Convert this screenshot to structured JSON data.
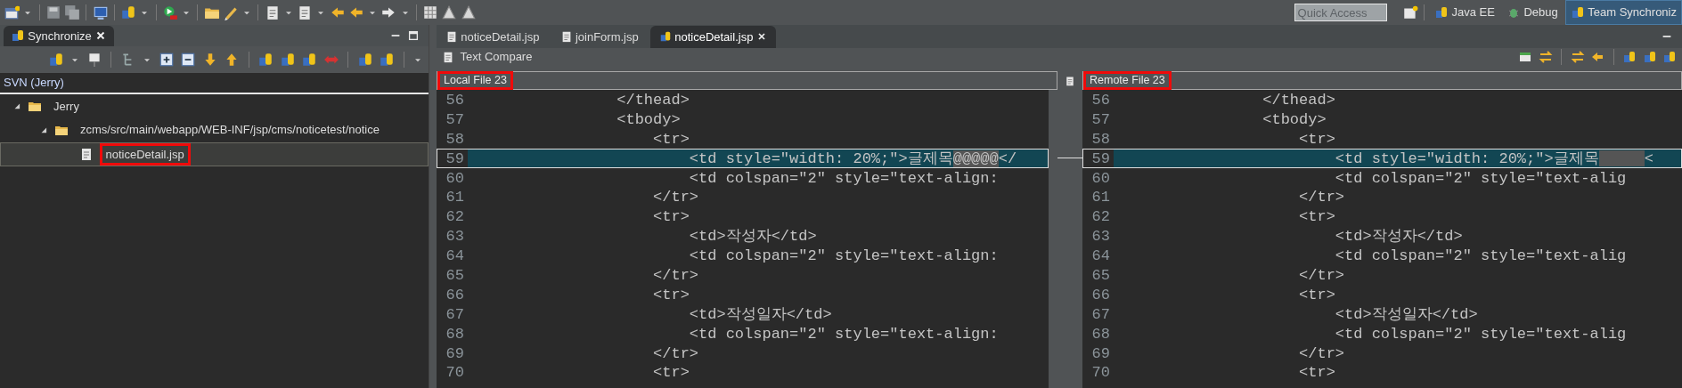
{
  "toolbar": {
    "quick_access": {
      "placeholder": "Quick Access"
    },
    "perspectives": [
      {
        "label": "Java EE",
        "selected": false
      },
      {
        "label": "Debug",
        "selected": false
      },
      {
        "label": "Team Synchroniz",
        "selected": true
      }
    ]
  },
  "sync_view": {
    "title": "Synchronize",
    "header": "SVN (Jerry)",
    "tree": [
      {
        "label": "Jerry",
        "kind": "project",
        "expanded": true,
        "selected": false,
        "highlighted": false,
        "children": [
          {
            "label": "zcms/src/main/webapp/WEB-INF/jsp/cms/noticetest/notice",
            "kind": "folder",
            "expanded": true,
            "selected": false,
            "highlighted": false,
            "children": [
              {
                "label": "noticeDetail.jsp",
                "kind": "file",
                "selected": true,
                "highlighted": true
              }
            ]
          }
        ]
      }
    ]
  },
  "editor": {
    "tabs": [
      {
        "label": "noticeDetail.jsp",
        "selected": false
      },
      {
        "label": "joinForm.jsp",
        "selected": false
      },
      {
        "label": "noticeDetail.jsp",
        "selected": true
      }
    ],
    "compare": {
      "title": "Text Compare",
      "left": {
        "header": "Local File 23",
        "highlighted": true,
        "lines": [
          {
            "number": "56",
            "code": "                </thead>",
            "selected": false
          },
          {
            "number": "57",
            "code": "                <tbody>",
            "selected": false
          },
          {
            "number": "58",
            "code": "                    <tr>",
            "selected": false
          },
          {
            "number": "59",
            "code": "                        <td style=\"width: 20%;\">글제목",
            "diff": "@@@@@",
            "tail": "</",
            "selected": true
          },
          {
            "number": "60",
            "code": "                        <td colspan=\"2\" style=\"text-align:",
            "selected": false
          },
          {
            "number": "61",
            "code": "                    </tr>",
            "selected": false
          },
          {
            "number": "62",
            "code": "                    <tr>",
            "selected": false
          },
          {
            "number": "63",
            "code": "                        <td>작성자</td>",
            "selected": false
          },
          {
            "number": "64",
            "code": "                        <td colspan=\"2\" style=\"text-align:",
            "selected": false
          },
          {
            "number": "65",
            "code": "                    </tr>",
            "selected": false
          },
          {
            "number": "66",
            "code": "                    <tr>",
            "selected": false
          },
          {
            "number": "67",
            "code": "                        <td>작성일자</td>",
            "selected": false
          },
          {
            "number": "68",
            "code": "                        <td colspan=\"2\" style=\"text-align:",
            "selected": false
          },
          {
            "number": "69",
            "code": "                    </tr>",
            "selected": false
          },
          {
            "number": "70",
            "code": "                    <tr>",
            "selected": false
          }
        ]
      },
      "right": {
        "header": "Remote File 23",
        "highlighted": true,
        "lines": [
          {
            "number": "56",
            "code": "                </thead>",
            "selected": false
          },
          {
            "number": "57",
            "code": "                <tbody>",
            "selected": false
          },
          {
            "number": "58",
            "code": "                    <tr>",
            "selected": false
          },
          {
            "number": "59",
            "code": "                        <td style=\"width: 20%;\">글제목",
            "diff_gap": true,
            "tail": "<",
            "selected": true
          },
          {
            "number": "60",
            "code": "                        <td colspan=\"2\" style=\"text-alig",
            "selected": false
          },
          {
            "number": "61",
            "code": "                    </tr>",
            "selected": false
          },
          {
            "number": "62",
            "code": "                    <tr>",
            "selected": false
          },
          {
            "number": "63",
            "code": "                        <td>작성자</td>",
            "selected": false
          },
          {
            "number": "64",
            "code": "                        <td colspan=\"2\" style=\"text-alig",
            "selected": false
          },
          {
            "number": "65",
            "code": "                    </tr>",
            "selected": false
          },
          {
            "number": "66",
            "code": "                    <tr>",
            "selected": false
          },
          {
            "number": "67",
            "code": "                        <td>작성일자</td>",
            "selected": false
          },
          {
            "number": "68",
            "code": "                        <td colspan=\"2\" style=\"text-alig",
            "selected": false
          },
          {
            "number": "69",
            "code": "                    </tr>",
            "selected": false
          },
          {
            "number": "70",
            "code": "                    <tr>",
            "selected": false
          }
        ]
      }
    }
  }
}
